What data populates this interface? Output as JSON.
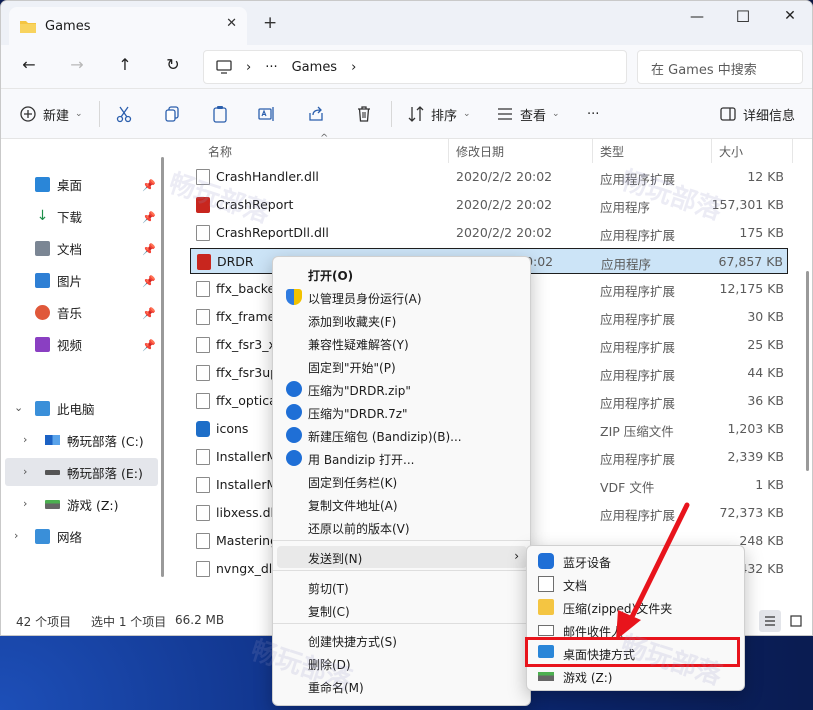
{
  "window": {
    "tab_title": "Games",
    "close_tab": "✕",
    "new_tab": "+",
    "minimize": "—",
    "maximize": "☐",
    "close": "✕"
  },
  "address": {
    "ellipsis": "···",
    "path_item": "Games",
    "search_placeholder": "在 Games 中搜索"
  },
  "toolbar": {
    "new_label": "新建",
    "sort_label": "排序",
    "view_label": "查看",
    "more_label": "···",
    "details_label": "详细信息"
  },
  "sidebar": {
    "quick": [
      {
        "label": "桌面"
      },
      {
        "label": "下载"
      },
      {
        "label": "文档"
      },
      {
        "label": "图片"
      },
      {
        "label": "音乐"
      },
      {
        "label": "视频"
      }
    ],
    "this_pc": "此电脑",
    "drives": [
      {
        "label": "畅玩部落 (C:)"
      },
      {
        "label": "畅玩部落 (E:)"
      },
      {
        "label": "游戏 (Z:)"
      }
    ],
    "network": "网络"
  },
  "columns": {
    "name": "名称",
    "date": "修改日期",
    "type": "类型",
    "size": "大小"
  },
  "files": [
    {
      "name": "CrashHandler.dll",
      "date": "2020/2/2 20:02",
      "type": "应用程序扩展",
      "size": "12 KB"
    },
    {
      "name": "CrashReport",
      "date": "2020/2/2 20:02",
      "type": "应用程序",
      "size": "157,301 KB"
    },
    {
      "name": "CrashReportDll.dll",
      "date": "2020/2/2 20:02",
      "type": "应用程序扩展",
      "size": "175 KB"
    },
    {
      "name": "DRDR",
      "date": "2020/2/2 20:02",
      "type": "应用程序",
      "size": "67,857 KB"
    },
    {
      "name": "ffx_backer",
      "date": "02",
      "type": "应用程序扩展",
      "size": "12,175 KB"
    },
    {
      "name": "ffx_framei",
      "date": "02",
      "type": "应用程序扩展",
      "size": "30 KB"
    },
    {
      "name": "ffx_fsr3_x6",
      "date": "02",
      "type": "应用程序扩展",
      "size": "25 KB"
    },
    {
      "name": "ffx_fsr3up",
      "date": "02",
      "type": "应用程序扩展",
      "size": "44 KB"
    },
    {
      "name": "ffx_optica",
      "date": "02",
      "type": "应用程序扩展",
      "size": "36 KB"
    },
    {
      "name": "icons",
      "date": "02",
      "type": "ZIP 压缩文件",
      "size": "1,203 KB"
    },
    {
      "name": "InstallerM",
      "date": "33",
      "type": "应用程序扩展",
      "size": "2,339 KB"
    },
    {
      "name": "InstallerM",
      "date": "33",
      "type": "VDF 文件",
      "size": "1 KB"
    },
    {
      "name": "libxess.dll",
      "date": "02",
      "type": "应用程序扩展",
      "size": "72,373 KB"
    },
    {
      "name": "Mastering",
      "date": "",
      "type": "",
      "size": "248 KB"
    },
    {
      "name": "nvngx_dls",
      "date": "",
      "type": "",
      "size": "432 KB"
    }
  ],
  "status": {
    "count": "42 个项目",
    "selected": "选中 1 个项目",
    "size": "66.2 MB"
  },
  "context_menu": {
    "items": [
      {
        "label": "打开(O)"
      },
      {
        "label": "以管理员身份运行(A)"
      },
      {
        "label": "添加到收藏夹(F)"
      },
      {
        "label": "兼容性疑难解答(Y)"
      },
      {
        "label": "固定到\"开始\"(P)"
      },
      {
        "label": "压缩为\"DRDR.zip\""
      },
      {
        "label": "压缩为\"DRDR.7z\""
      },
      {
        "label": "新建压缩包 (Bandizip)(B)..."
      },
      {
        "label": "用 Bandizip 打开..."
      },
      {
        "label": "固定到任务栏(K)"
      },
      {
        "label": "复制文件地址(A)"
      },
      {
        "label": "还原以前的版本(V)"
      },
      {
        "label": "发送到(N)"
      },
      {
        "label": "剪切(T)"
      },
      {
        "label": "复制(C)"
      },
      {
        "label": "创建快捷方式(S)"
      },
      {
        "label": "删除(D)"
      },
      {
        "label": "重命名(M)"
      }
    ]
  },
  "send_to": {
    "items": [
      {
        "label": "蓝牙设备"
      },
      {
        "label": "文档"
      },
      {
        "label": "压缩(zipped)文件夹"
      },
      {
        "label": "邮件收件人"
      },
      {
        "label": "桌面快捷方式"
      },
      {
        "label": "游戏 (Z:)"
      }
    ]
  },
  "colors": {
    "accent": "#e8141c",
    "selection": "#cce4f7"
  }
}
